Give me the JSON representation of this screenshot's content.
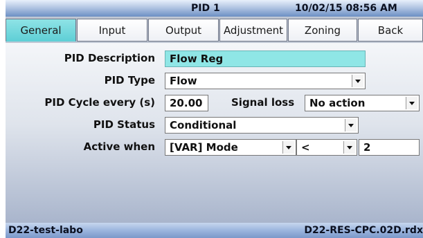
{
  "title": "PID 1",
  "datetime": "10/02/15 08:56 AM",
  "tabs": [
    "General",
    "Input",
    "Output",
    "Adjustment",
    "Zoning",
    "Back"
  ],
  "active_tab": "General",
  "form": {
    "description_label": "PID Description",
    "description_value": "Flow Reg",
    "type_label": "PID Type",
    "type_value": "Flow",
    "cycle_label": "PID Cycle every (s)",
    "cycle_value": "20.00",
    "signal_loss_label": "Signal loss",
    "signal_loss_value": "No action",
    "status_label": "PID Status",
    "status_value": "Conditional",
    "active_when_label": "Active when",
    "active_when_var": "[VAR] Mode",
    "active_when_operator": "<",
    "active_when_value": "2"
  },
  "status": {
    "left": "D22-test-labo",
    "right": "D22-RES-CPC.02D.rdx"
  },
  "colors": {
    "active_tab": "#6ad6dc",
    "description_field": "#8fe6e6",
    "titlebar": "#7f9fd0"
  }
}
